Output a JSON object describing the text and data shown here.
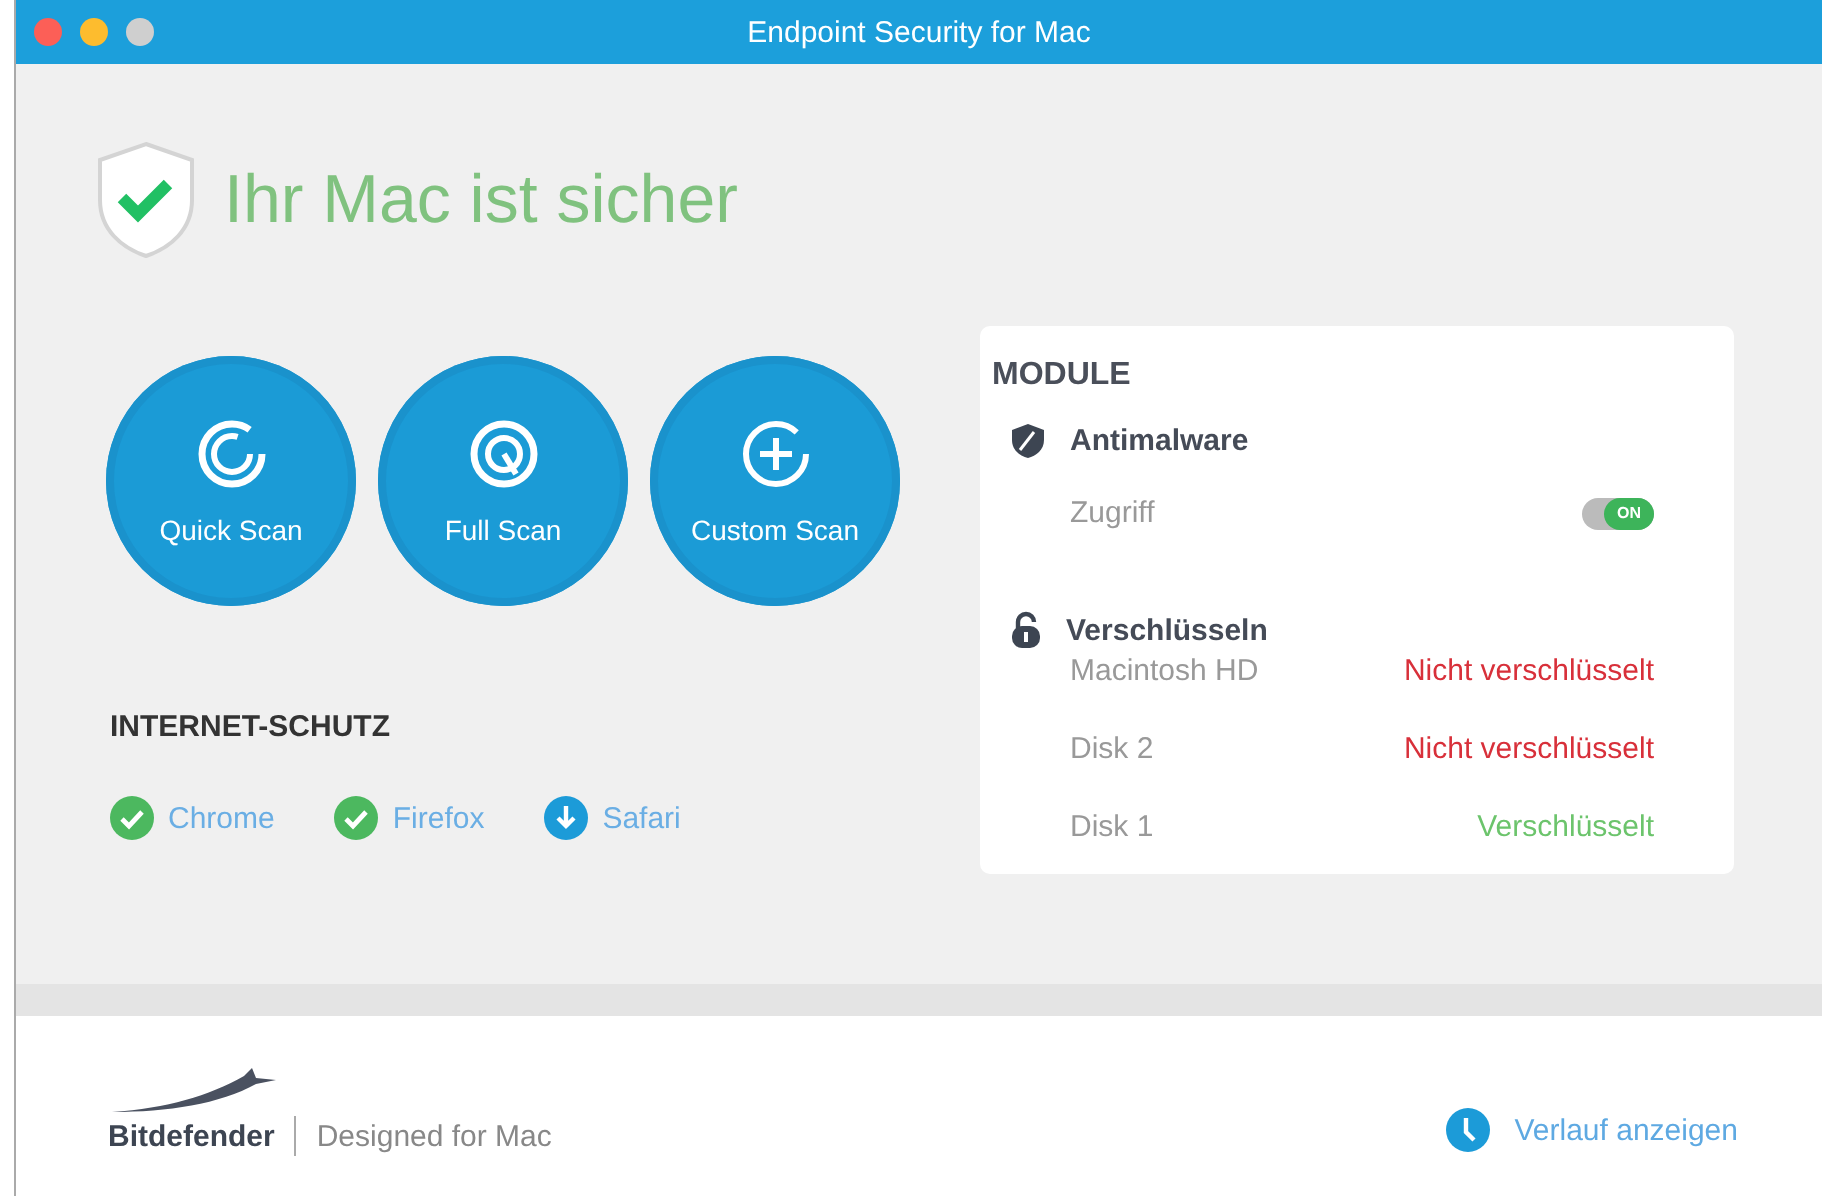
{
  "window": {
    "title": "Endpoint Security for Mac"
  },
  "status": {
    "headline": "Ihr Mac ist sicher",
    "safe": true
  },
  "scan_buttons": [
    {
      "kind": "quick",
      "label": "Quick Scan"
    },
    {
      "kind": "full",
      "label": "Full Scan"
    },
    {
      "kind": "custom",
      "label": "Custom Scan"
    }
  ],
  "internet_protection": {
    "title": "INTERNET-SCHUTZ",
    "browsers": [
      {
        "name": "Chrome",
        "kind": "installed"
      },
      {
        "name": "Firefox",
        "kind": "installed"
      },
      {
        "name": "Safari",
        "kind": "download"
      }
    ]
  },
  "modules": {
    "title": "MODULE",
    "antimalware": {
      "title": "Antimalware",
      "settings": [
        {
          "label": "Zugriff",
          "on": true,
          "toggle_text": "ON"
        }
      ]
    },
    "encryption": {
      "title": "Verschlüsseln",
      "disks": [
        {
          "name": "Macintosh HD",
          "status": "Nicht verschlüsselt",
          "encrypted": false
        },
        {
          "name": "Disk 2",
          "status": "Nicht verschlüsselt",
          "encrypted": false
        },
        {
          "name": "Disk 1",
          "status": "Verschlüsselt",
          "encrypted": true
        }
      ]
    }
  },
  "footer": {
    "brand": "Bitdefender",
    "tagline": "Designed for Mac",
    "history_link": "Verlauf anzeigen"
  }
}
